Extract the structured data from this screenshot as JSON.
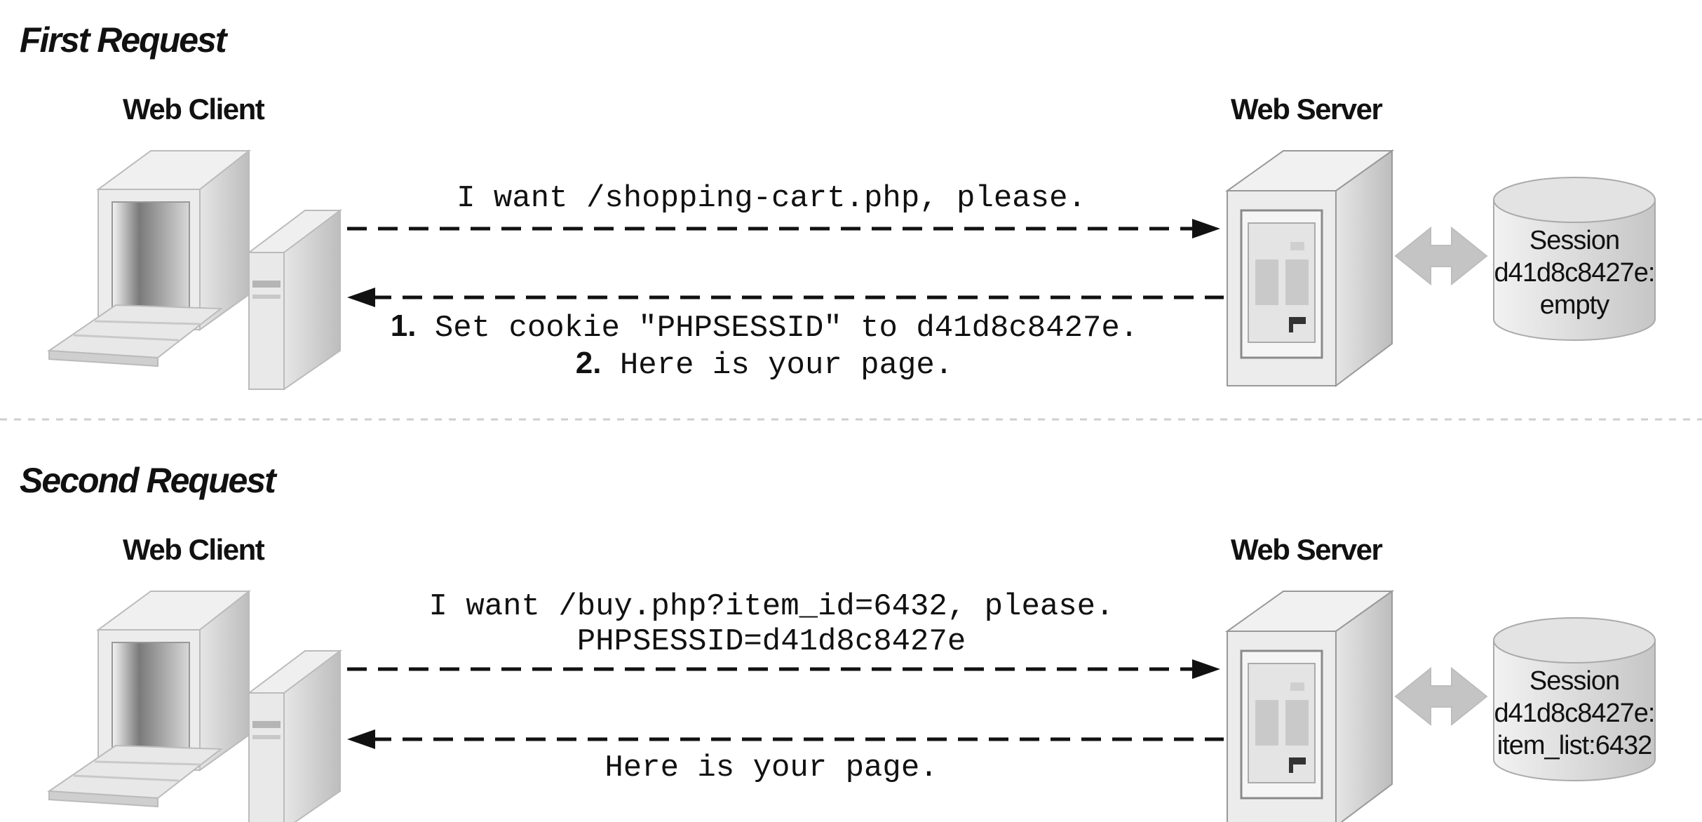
{
  "first_request": {
    "title": "First Request",
    "client_label": "Web Client",
    "server_label": "Web Server",
    "request_text": "I want /shopping-cart.php, please.",
    "response_step1_num": "1.",
    "response_step1_text": " Set cookie \"PHPSESSID\" to d41d8c8427e.",
    "response_step2_num": "2.",
    "response_step2_text": " Here is your page.",
    "session": {
      "line1": "Session",
      "line2": "d41d8c8427e:",
      "line3": "empty"
    }
  },
  "second_request": {
    "title": "Second Request",
    "client_label": "Web Client",
    "server_label": "Web Server",
    "request_line1": "I want /buy.php?item_id=6432, please.",
    "request_line2": "PHPSESSID=d41d8c8427e",
    "response_text": "Here is your page.",
    "session": {
      "line1": "Session",
      "line2": "d41d8c8427e:",
      "line3": "item_list:6432"
    }
  }
}
